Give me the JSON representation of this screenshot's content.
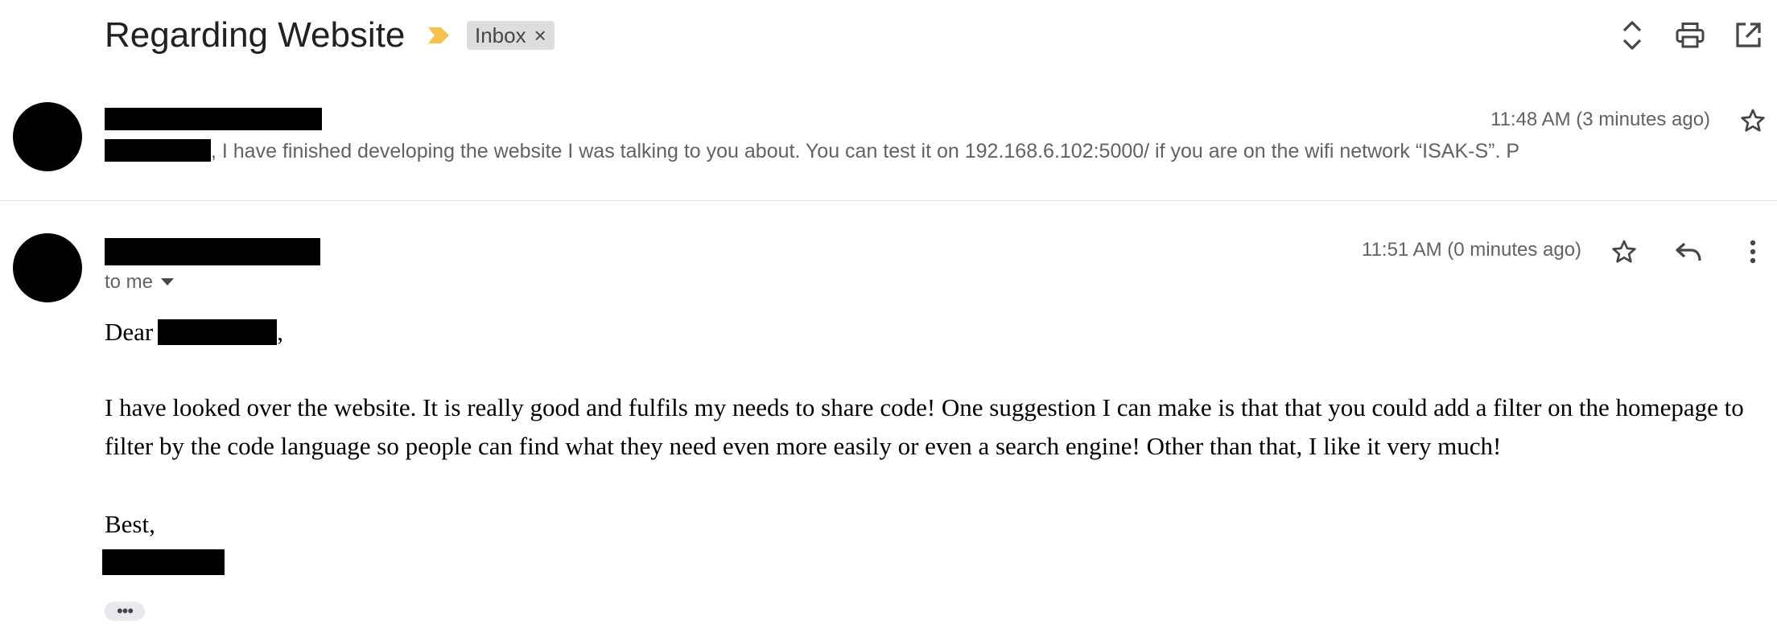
{
  "thread": {
    "subject": "Regarding Website",
    "label": "Inbox",
    "label_remove": "×",
    "importance_color": "#f2c14e",
    "icons": [
      "expand-all-icon",
      "print-icon",
      "open-in-new-window-icon"
    ]
  },
  "messages": [
    {
      "time": "11:48 AM (3 minutes ago)",
      "snippet": ", I have finished developing the website I was talking to you about. You can test it on 192.168.6.102:5000/ if you are on the wifi network “ISAK-S”. P",
      "icons": [
        "star-icon"
      ]
    },
    {
      "time": "11:51 AM (0 minutes ago)",
      "recipient": "to me",
      "greeting_start": "Dear",
      "greeting_end": ",",
      "body": "I have looked over the website. It is really good and fulfils my needs to share code! One suggestion I can make is that that you could add a filter on the homepage to filter by the code language so people can find what they need even more easily or even a search engine! Other than that, I like it very much!",
      "closing": "Best,",
      "trimmed_content": "•••",
      "icons": [
        "star-icon",
        "reply-icon",
        "more-vertical-icon"
      ]
    }
  ]
}
